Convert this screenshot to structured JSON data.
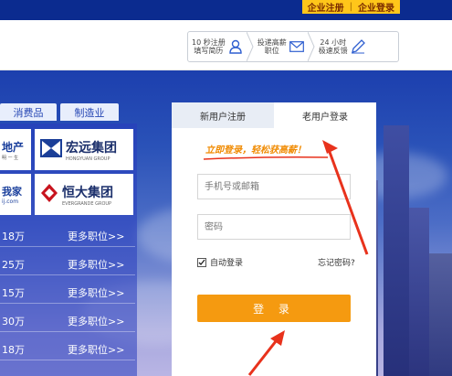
{
  "top_links": {
    "register": "企业注册",
    "sep": "|",
    "login": "企业登录"
  },
  "steps": [
    {
      "line1": "10 秒注册",
      "line2": "填写简历",
      "icon": "user-icon"
    },
    {
      "line1": "投递高薪",
      "line2": "职位",
      "icon": "envelope-icon"
    },
    {
      "line1": "24 小时",
      "line2": "极速反馈",
      "icon": "pencil-icon"
    }
  ],
  "categories": [
    "消费品",
    "制造业"
  ],
  "logos": {
    "left_top": {
      "text": "地产",
      "sub": "明 一 生"
    },
    "right_top": {
      "text": "宏远集团",
      "sub": "HONGYUAN GROUP"
    },
    "left_bottom": {
      "text": "我家",
      "sub": "ij.com"
    },
    "right_bottom": {
      "text": "恒大集团",
      "sub": "EVERGRANDE GROUP"
    }
  },
  "jobs": [
    {
      "salary": "18万",
      "more": "更多职位>>"
    },
    {
      "salary": "25万",
      "more": "更多职位>>"
    },
    {
      "salary": "15万",
      "more": "更多职位>>"
    },
    {
      "salary": "30万",
      "more": "更多职位>>"
    },
    {
      "salary": "18万",
      "more": "更多职位>>"
    }
  ],
  "login": {
    "tab_new": "新用户注册",
    "tab_old": "老用户登录",
    "slogan": "立即登录，轻松获高薪！",
    "phone_placeholder": "手机号或邮箱",
    "password_placeholder": "密码",
    "auto_login": "自动登录",
    "auto_checked": true,
    "forgot": "忘记密码?",
    "submit": "登  录"
  },
  "colors": {
    "topbar": "#0b2b8f",
    "top_links_bg": "#ffc61a",
    "accent": "#f59a10",
    "annotation": "#e8321c"
  }
}
